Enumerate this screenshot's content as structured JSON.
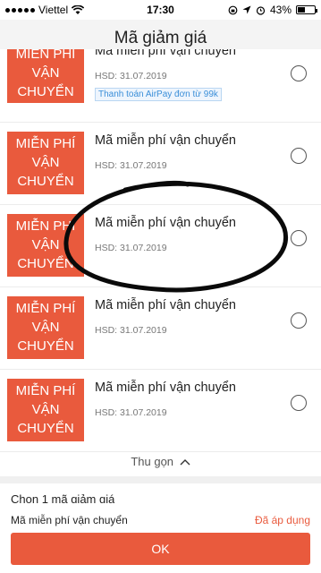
{
  "status_bar": {
    "carrier": "Viettel",
    "time": "17:30",
    "battery": "43%",
    "battery_level": 0.43
  },
  "title": "Mã giảm giá",
  "vouchers": [
    {
      "stamp_line1": "MIỄN PHÍ",
      "stamp_line2": "VẬN",
      "stamp_line3": "CHUYỂN",
      "name": "Mã miễn phí vận chuyển",
      "expiry": "HSD: 31.07.2019",
      "tag": "Thanh toán AirPay đơn từ 99k"
    },
    {
      "stamp_line1": "MIỄN PHÍ",
      "stamp_line2": "VẬN",
      "stamp_line3": "CHUYỂN",
      "name": "Mã miễn phí vận chuyển",
      "expiry": "HSD: 31.07.2019"
    },
    {
      "stamp_line1": "MIỄN PHÍ",
      "stamp_line2": "VẬN",
      "stamp_line3": "CHUYỂN",
      "name": "Mã miễn phí vận chuyển",
      "expiry": "HSD: 31.07.2019"
    },
    {
      "stamp_line1": "MIỄN PHÍ",
      "stamp_line2": "VẬN",
      "stamp_line3": "CHUYỂN",
      "name": "Mã miễn phí vận chuyển",
      "expiry": "HSD: 31.07.2019"
    },
    {
      "stamp_line1": "MIỄN PHÍ",
      "stamp_line2": "VẬN",
      "stamp_line3": "CHUYỂN",
      "name": "Mã miễn phí vận chuyển",
      "expiry": "HSD: 31.07.2019"
    }
  ],
  "collapse_label": "Thu gọn",
  "footer": {
    "pick_label": "Chọn 1 mã giảm giá",
    "selected_name": "Mã miễn phí vận chuyển",
    "applied_label": "Đã áp dụng",
    "ok_label": "OK"
  },
  "colors": {
    "accent": "#e95a3d",
    "tag_blue": "#3a8ed8"
  }
}
